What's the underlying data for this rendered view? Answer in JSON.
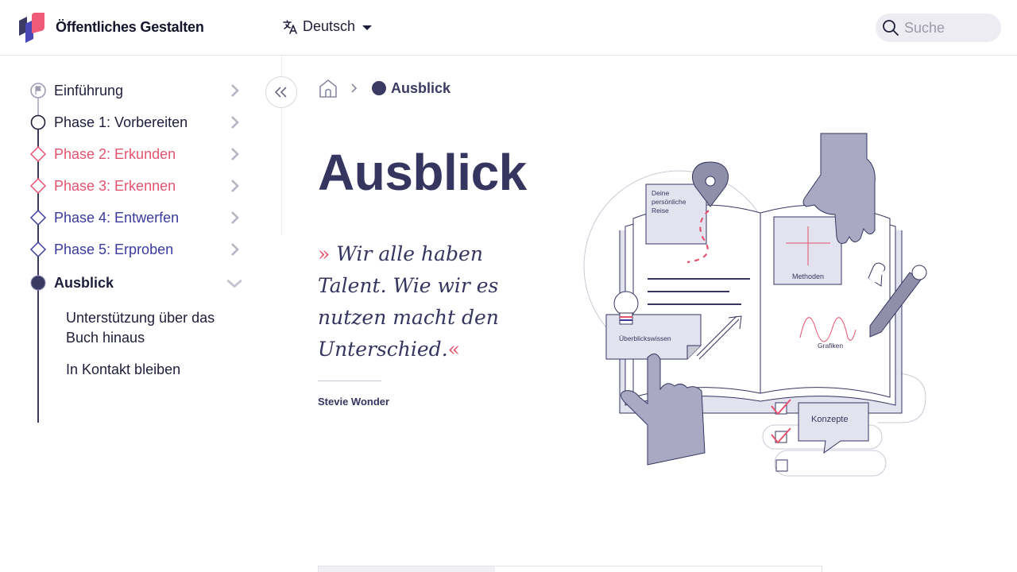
{
  "header": {
    "brand": "Öffentliches Gestalten",
    "language": "Deutsch",
    "search_placeholder": "Suche",
    "icons": {
      "logo": "brand-logo",
      "translate": "translate-icon",
      "dropdown": "caret-down-icon",
      "search": "search-icon"
    }
  },
  "sidebar": {
    "items": [
      {
        "label": "Einführung",
        "color": "#1e1e3a",
        "marker": "flag"
      },
      {
        "label": "Phase 1: Vorbereiten",
        "color": "#1e1e3a",
        "marker": "circle"
      },
      {
        "label": "Phase 2: Erkunden",
        "color": "#e5536f",
        "marker": "diamond"
      },
      {
        "label": "Phase 3: Erkennen",
        "color": "#e5536f",
        "marker": "diamond"
      },
      {
        "label": "Phase 4: Entwerfen",
        "color": "#3a3a9e",
        "marker": "diamond"
      },
      {
        "label": "Phase 5: Erproben",
        "color": "#3a3a9e",
        "marker": "diamond"
      },
      {
        "label": "Ausblick",
        "color": "#1e1e3a",
        "marker": "filled-circle",
        "active": true
      }
    ],
    "sub_items": [
      {
        "label": "Unterstützung über das Buch hinaus"
      },
      {
        "label": "In Kontakt bleiben"
      }
    ]
  },
  "breadcrumb": {
    "current": "Ausblick",
    "icons": {
      "home": "home-icon",
      "separator": "chevron-right-icon"
    }
  },
  "main": {
    "title": "Ausblick",
    "quote_open": "»",
    "quote": "Wir alle haben Talent. Wie wir es nutzen macht den Unterschied.",
    "quote_close": "«",
    "author": "Stevie Wonder"
  },
  "illustration": {
    "labels": {
      "journey": [
        "Deine",
        "persönliche",
        "Reise"
      ],
      "methods": "Methoden",
      "overview": "Überblickswissen",
      "graphics": "Grafiken",
      "concepts": "Konzepte"
    }
  },
  "colors": {
    "navy": "#363560",
    "pink": "#e5536f",
    "blue": "#3a3a9e",
    "lavender": "#e3e3ef",
    "hand": "#a9a9c3"
  }
}
